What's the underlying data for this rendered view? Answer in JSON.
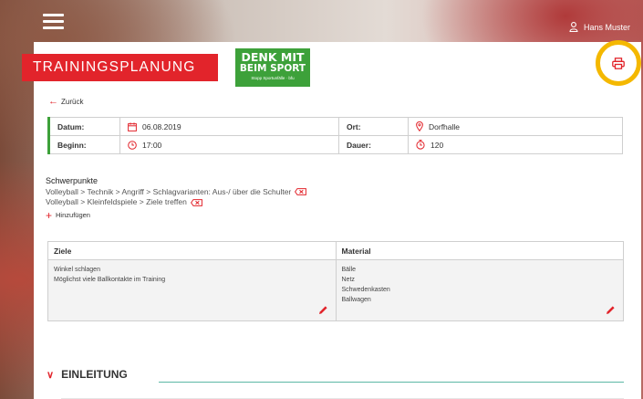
{
  "header": {
    "user_name": "Hans Muster"
  },
  "brand": {
    "title": "TRAININGSPLANUNG"
  },
  "logo": {
    "line1": "DENK MIT",
    "line2": "BEIM SPORT",
    "tagline": "Stopp Sportunfälle · bfu"
  },
  "nav": {
    "back_label": "Zurück"
  },
  "info": {
    "datum_label": "Datum:",
    "datum_value": "06.08.2019",
    "ort_label": "Ort:",
    "ort_value": "Dorfhalle",
    "beginn_label": "Beginn:",
    "beginn_value": "17:00",
    "dauer_label": "Dauer:",
    "dauer_value": "120"
  },
  "schwerpunkte": {
    "title": "Schwerpunkte",
    "items": [
      "Volleyball > Technik > Angriff > Schlagvarianten: Aus-/ über die Schulter",
      "Volleyball > Kleinfeldspiele > Ziele treffen"
    ],
    "add_label": "Hinzufügen"
  },
  "ziele": {
    "header": "Ziele",
    "items": [
      "Winkel schlagen",
      "Möglichst viele Ballkontakte im Training"
    ]
  },
  "material": {
    "header": "Material",
    "items": [
      "Bälle",
      "Netz",
      "Schwedenkasten",
      "Ballwagen"
    ]
  },
  "section": {
    "einleitung": "EINLEITUNG"
  },
  "colors": {
    "brand_red": "#e2242b",
    "green": "#3da13a",
    "highlight": "#f4b800",
    "teal": "#5cb8a5"
  }
}
